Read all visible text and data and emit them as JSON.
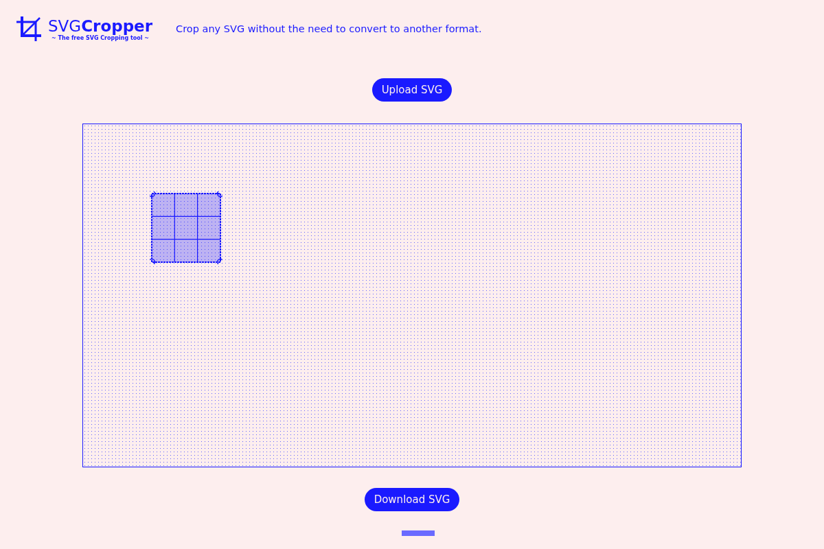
{
  "header": {
    "title": "SVG**Cropper**",
    "subtitle": "~ The free SVG Cropping tool ~",
    "tagline": "Crop any SVG without the need to convert to another format."
  },
  "upload_button": "Upload SVG",
  "download_button": "Download SVG"
}
